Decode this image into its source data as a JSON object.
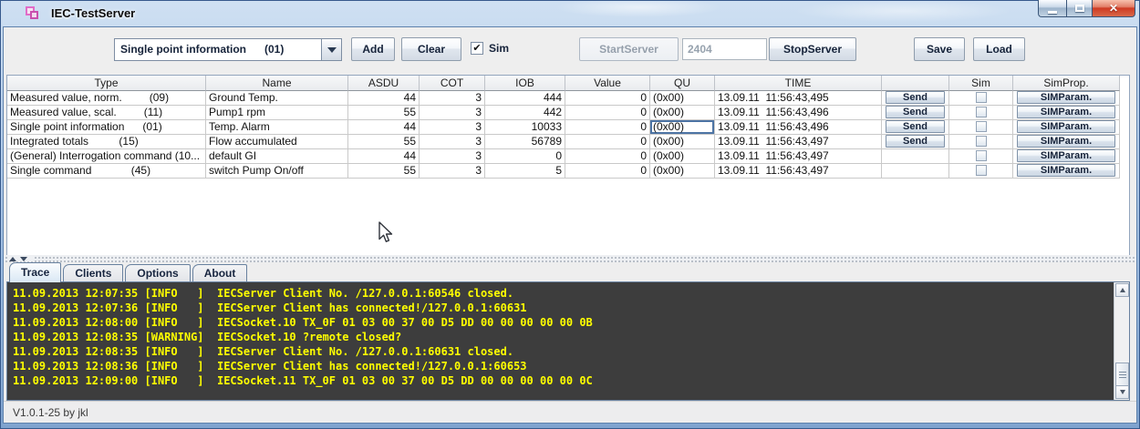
{
  "window": {
    "title": "IEC-TestServer",
    "status_text": "V1.0.1-25 by jkl"
  },
  "toolbar": {
    "type_select_value": "Single point information      (01)",
    "add": "Add",
    "clear": "Clear",
    "sim_checkbox_label": "Sim",
    "sim_checked": true,
    "start_server": "StartServer",
    "start_server_enabled": false,
    "port_value": "2404",
    "stop_server": "StopServer",
    "save": "Save",
    "load": "Load"
  },
  "table": {
    "headers": {
      "type": "Type",
      "name": "Name",
      "asdu": "ASDU",
      "cot": "COT",
      "iob": "IOB",
      "value": "Value",
      "qu": "QU",
      "time": "TIME",
      "send": "",
      "sim": "Sim",
      "simprop": "SimProp."
    },
    "send_label": "Send",
    "simparam_label": "SIMParam.",
    "selected_cell": {
      "row_index": 2,
      "column": "qu"
    },
    "rows": [
      {
        "type": "Measured value, norm.         (09)",
        "name": "Ground Temp.",
        "asdu": "44",
        "cot": "3",
        "iob": "444",
        "value": "0",
        "qu": "(0x00)",
        "time": "13.09.11  11:56:43,495",
        "has_send": true,
        "sim_checked": false
      },
      {
        "type": "Measured value, scal.         (11)",
        "name": "Pump1 rpm",
        "asdu": "55",
        "cot": "3",
        "iob": "442",
        "value": "0",
        "qu": "(0x00)",
        "time": "13.09.11  11:56:43,496",
        "has_send": true,
        "sim_checked": false
      },
      {
        "type": "Single point information      (01)",
        "name": "Temp. Alarm",
        "asdu": "44",
        "cot": "3",
        "iob": "10033",
        "value": "0",
        "qu": "(0x00)",
        "time": "13.09.11  11:56:43,496",
        "has_send": true,
        "sim_checked": false
      },
      {
        "type": "Integrated totals          (15)",
        "name": "Flow accumulated",
        "asdu": "55",
        "cot": "3",
        "iob": "56789",
        "value": "0",
        "qu": "(0x00)",
        "time": "13.09.11  11:56:43,497",
        "has_send": true,
        "sim_checked": false
      },
      {
        "type": "(General) Interrogation command (10...",
        "name": "default GI",
        "asdu": "44",
        "cot": "3",
        "iob": "0",
        "value": "0",
        "qu": "(0x00)",
        "time": "13.09.11  11:56:43,497",
        "has_send": false,
        "sim_checked": false
      },
      {
        "type": "Single command             (45)",
        "name": "switch Pump On/off",
        "asdu": "55",
        "cot": "3",
        "iob": "5",
        "value": "0",
        "qu": "(0x00)",
        "time": "13.09.11  11:56:43,497",
        "has_send": false,
        "sim_checked": false
      }
    ]
  },
  "tabs": [
    {
      "label": "Trace",
      "selected": true
    },
    {
      "label": "Clients",
      "selected": false
    },
    {
      "label": "Options",
      "selected": false
    },
    {
      "label": "About",
      "selected": false
    }
  ],
  "log": {
    "lines": [
      "11.09.2013 12:07:35 [INFO   ]  IECServer Client No. /127.0.0.1:60546 closed.",
      "11.09.2013 12:07:36 [INFO   ]  IECServer Client has connected!/127.0.0.1:60631",
      "11.09.2013 12:08:00 [INFO   ]  IECSocket.10 TX_0F 01 03 00 37 00 D5 DD 00 00 00 00 00 0B",
      "11.09.2013 12:08:35 [WARNING]  IECSocket.10 ?remote closed?",
      "11.09.2013 12:08:35 [INFO   ]  IECServer Client No. /127.0.0.1:60631 closed.",
      "11.09.2013 12:08:36 [INFO   ]  IECServer Client has connected!/127.0.0.1:60653",
      "11.09.2013 12:09:00 [INFO   ]  IECSocket.11 TX_0F 01 03 00 37 00 D5 DD 00 00 00 00 00 0C"
    ]
  },
  "colors": {
    "log_background": "#3d3d3d",
    "log_text": "#ffff00",
    "titlebar_accent": "#a9c6e6",
    "cell_selection_border": "#4d74a4"
  }
}
